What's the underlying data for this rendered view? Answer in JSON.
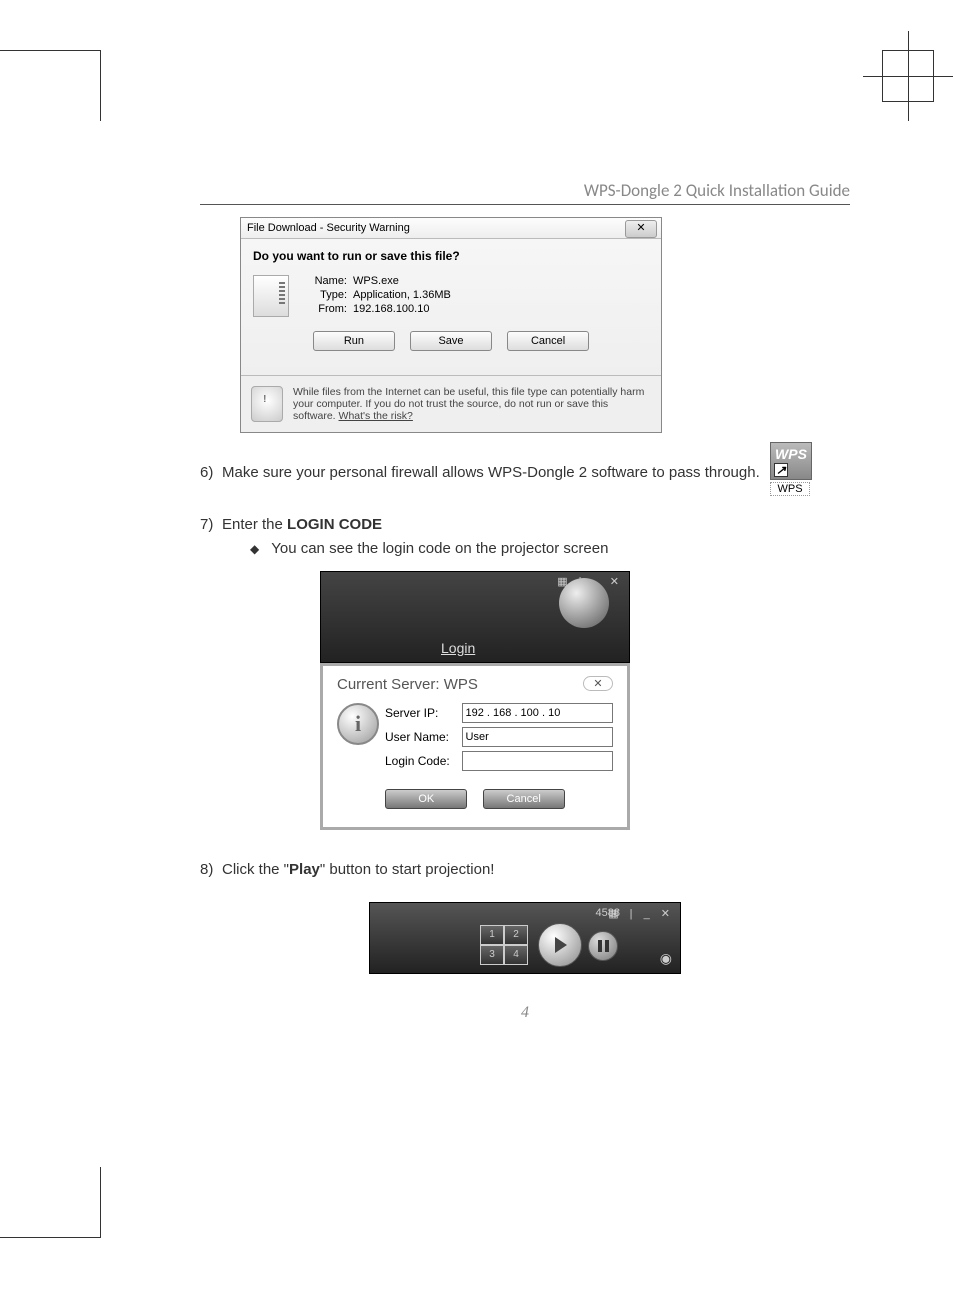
{
  "header": {
    "title": "WPS-Dongle 2 Quick Installation Guide"
  },
  "download_dialog": {
    "title": "File Download - Security Warning",
    "question": "Do you want to run or save this file?",
    "name_label": "Name:",
    "name_value": "WPS.exe",
    "type_label": "Type:",
    "type_value": "Application, 1.36MB",
    "from_label": "From:",
    "from_value": "192.168.100.10",
    "run": "Run",
    "save": "Save",
    "cancel": "Cancel",
    "warning": "While files from the Internet can be useful, this file type can potentially harm your computer. If you do not trust the source, do not run or save this software. ",
    "risk": "What's the risk?"
  },
  "shortcut": {
    "icon_text": "WPS",
    "label": "WPS"
  },
  "step6": {
    "num": "6)",
    "text": "Make sure your personal firewall allows WPS-Dongle 2 software to pass through."
  },
  "step7": {
    "num": "7)",
    "text_a": "Enter the ",
    "bold": "LOGIN CODE",
    "bullet": "You can see the login code on the projector screen"
  },
  "login": {
    "top_label": "Login",
    "header": "Current Server: WPS",
    "server_ip_label": "Server IP:",
    "server_ip_value": "192 . 168 . 100 . 10",
    "user_label": "User Name:",
    "user_value": "User",
    "code_label": "Login Code:",
    "code_value": "",
    "ok": "OK",
    "cancel": "Cancel"
  },
  "step8": {
    "num": "8)",
    "text_a": "Click the \"",
    "bold": "Play",
    "text_b": "\" button to start projection!"
  },
  "playbar": {
    "code": "4588",
    "q1": "1",
    "q2": "2",
    "q3": "3",
    "q4": "4"
  },
  "page_number": "4"
}
